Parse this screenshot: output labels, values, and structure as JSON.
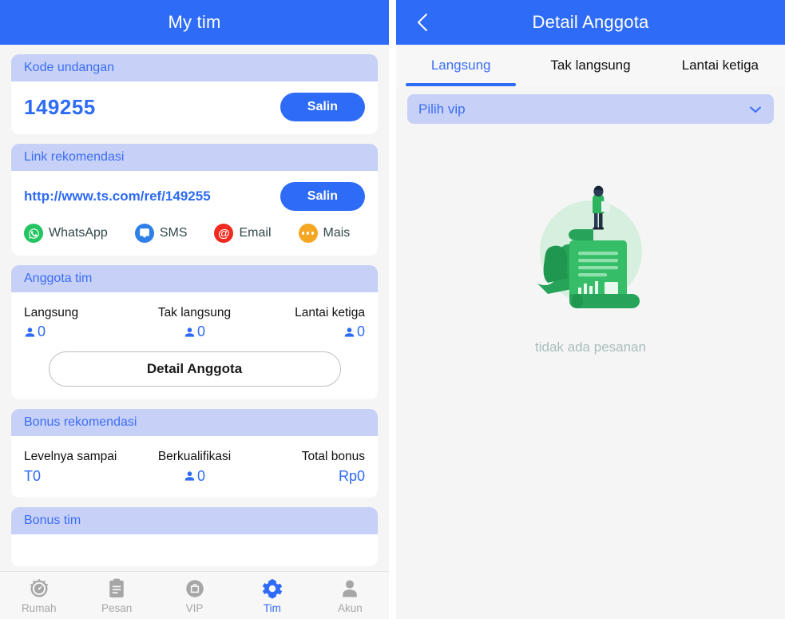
{
  "left": {
    "appbar": {
      "title": "My tim"
    },
    "invite_card": {
      "header": "Kode undangan",
      "code": "149255",
      "copy_label": "Salin"
    },
    "link_card": {
      "header": "Link rekomendasi",
      "url": "http://www.ts.com/ref/149255",
      "copy_label": "Salin",
      "share": [
        {
          "label": "WhatsApp",
          "icon": "whatsapp-icon",
          "color": "#25C463"
        },
        {
          "label": "SMS",
          "icon": "sms-icon",
          "color": "#2E7FE8"
        },
        {
          "label": "Email",
          "icon": "email-icon",
          "color": "#F02A1E"
        },
        {
          "label": "Mais",
          "icon": "more-icon",
          "color": "#F5A623"
        }
      ]
    },
    "members_card": {
      "header": "Anggota tim",
      "stats": [
        {
          "label": "Langsung",
          "value": "0"
        },
        {
          "label": "Tak langsung",
          "value": "0"
        },
        {
          "label": "Lantai ketiga",
          "value": "0"
        }
      ],
      "detail_button": "Detail Anggota"
    },
    "bonus_card": {
      "header": "Bonus rekomendasi",
      "stats": [
        {
          "label": "Levelnya sampai",
          "value": "T0",
          "has_person_icon": false
        },
        {
          "label": "Berkualifikasi",
          "value": "0",
          "has_person_icon": true
        },
        {
          "label": "Total bonus",
          "value": "Rp0",
          "has_person_icon": false
        }
      ]
    },
    "team_bonus_card": {
      "header": "Bonus tim"
    },
    "tabbar": [
      {
        "label": "Rumah",
        "icon": "speedometer-icon",
        "active": false
      },
      {
        "label": "Pesan",
        "icon": "clipboard-icon",
        "active": false
      },
      {
        "label": "VIP",
        "icon": "shopping-bag-icon",
        "active": false
      },
      {
        "label": "Tim",
        "icon": "gear-icon",
        "active": true
      },
      {
        "label": "Akun",
        "icon": "person-icon",
        "active": false
      }
    ]
  },
  "right": {
    "appbar": {
      "title": "Detail Anggota",
      "back_icon": "chevron-left-icon"
    },
    "tabs": [
      {
        "label": "Langsung",
        "active": true
      },
      {
        "label": "Tak langsung",
        "active": false
      },
      {
        "label": "Lantai ketiga",
        "active": false
      }
    ],
    "select": {
      "value": "Pilih vip",
      "icon": "chevron-down-icon"
    },
    "empty": {
      "text": "tidak ada pesanan",
      "illustration": "person-on-document-illustration"
    }
  },
  "colors": {
    "brand_blue": "#2e6bf6",
    "card_header_bg": "#c7d0f7",
    "card_header_text": "#3b6ef5",
    "page_bg": "#f5f5f5",
    "muted_gray": "#a6a6a6",
    "empty_text": "#a9bdbd"
  }
}
